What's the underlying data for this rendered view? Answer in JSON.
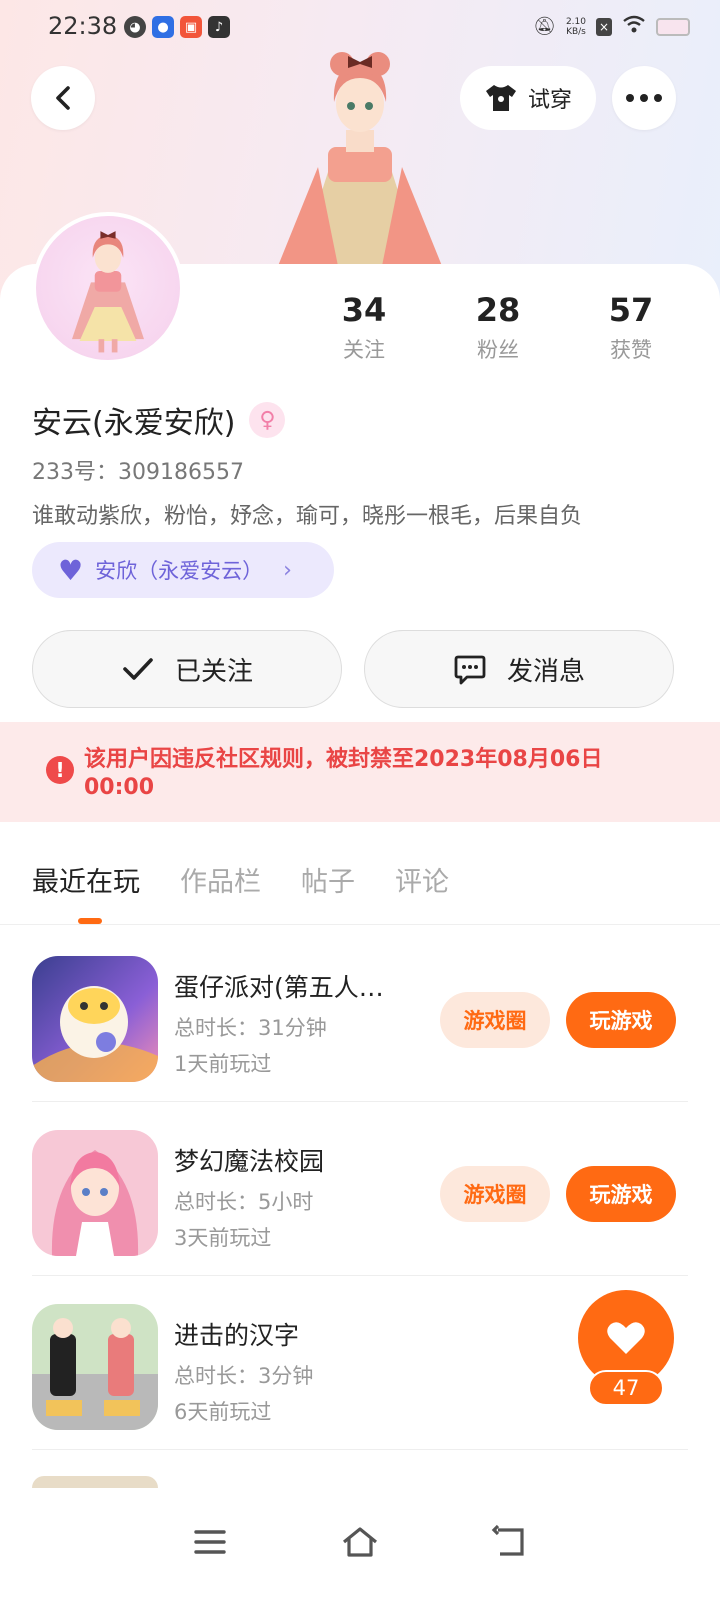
{
  "status_bar": {
    "time": "22:38",
    "net_speed_value": "2.10",
    "net_speed_unit": "KB/s",
    "icons": [
      "notification-app-icon",
      "baidu-icon",
      "kuaishou-icon",
      "tiktok-icon",
      "mute-icon",
      "wifi-icon",
      "battery-icon"
    ]
  },
  "header": {
    "tryon_label": "试穿",
    "icons": [
      "back-icon",
      "tshirt-icon",
      "more-icon"
    ]
  },
  "profile": {
    "stats": [
      {
        "value": "34",
        "label": "关注"
      },
      {
        "value": "28",
        "label": "粉丝"
      },
      {
        "value": "57",
        "label": "获赞"
      }
    ],
    "username": "安云(永爱安欣)",
    "gender_symbol": "♀",
    "uid": "233号：309186557",
    "bio": "谁敢动紫欣，粉怡，妤念，瑜可，晓彤一根毛，后果自负",
    "couple_tag": "安欣（永爱安云）"
  },
  "actions": {
    "follow_label": "已关注",
    "message_label": "发消息"
  },
  "ban_notice": {
    "text": "该用户因违反社区规则，被封禁至2023年08月06日 00:00",
    "color": "#e94545"
  },
  "tabs": [
    {
      "label": "最近在玩",
      "active": true
    },
    {
      "label": "作品栏",
      "active": false
    },
    {
      "label": "帖子",
      "active": false
    },
    {
      "label": "评论",
      "active": false
    }
  ],
  "games": [
    {
      "name": "蛋仔派对(第五人…",
      "duration": "总时长：31分钟",
      "last_played": "1天前玩过",
      "circle_label": "游戏圈",
      "play_label": "玩游戏"
    },
    {
      "name": "梦幻魔法校园",
      "duration": "总时长：5小时",
      "last_played": "3天前玩过",
      "circle_label": "游戏圈",
      "play_label": "玩游戏"
    },
    {
      "name": "进击的汉字",
      "duration": "总时长：3分钟",
      "last_played": "6天前玩过"
    }
  ],
  "like_button": {
    "count": "47"
  },
  "colors": {
    "accent": "#ff6a13",
    "accent_light": "#fde8dc",
    "couple_purple": "#6e63d9",
    "ban_bg": "#fdeaea"
  }
}
